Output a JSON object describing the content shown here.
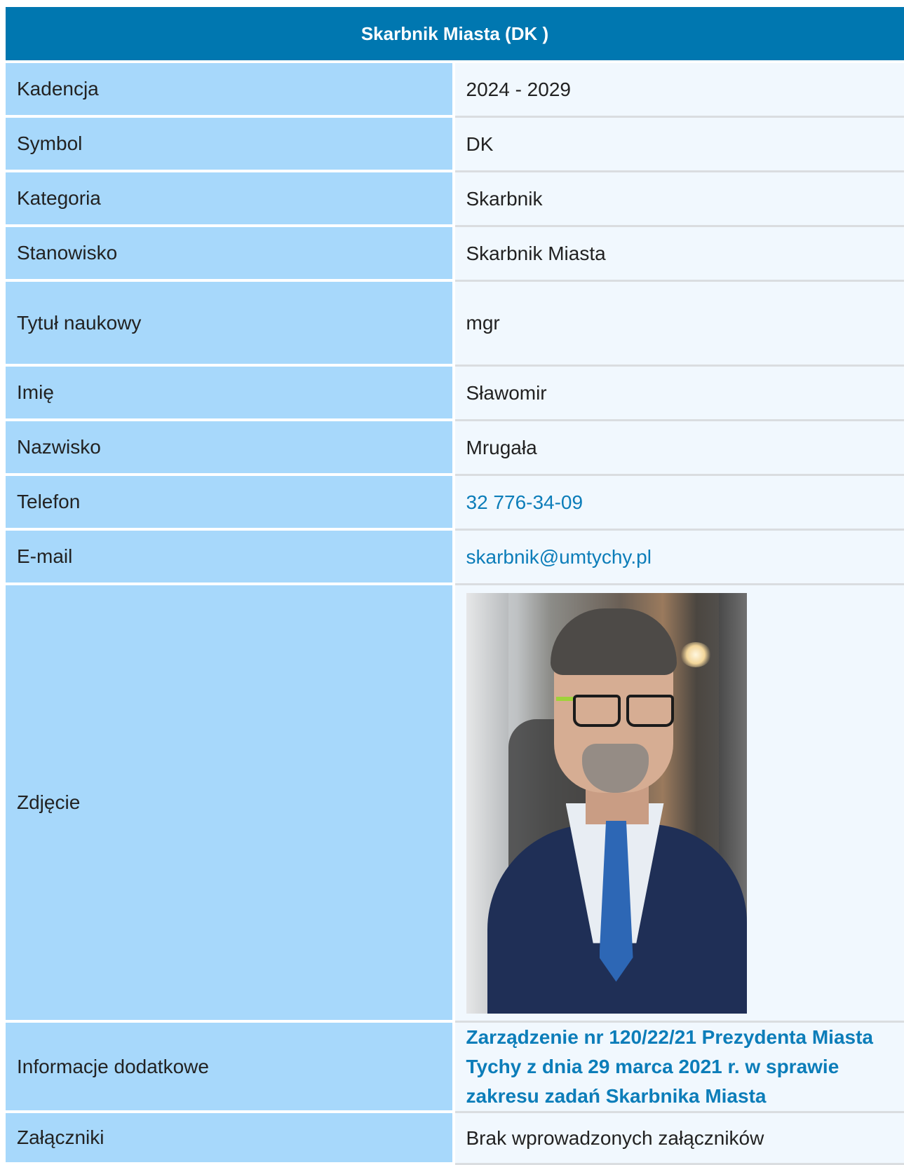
{
  "header": {
    "title": "Skarbnik Miasta (DK )"
  },
  "rows": {
    "kadencja": {
      "label": "Kadencja",
      "value": "2024 - 2029"
    },
    "symbol": {
      "label": "Symbol",
      "value": "DK"
    },
    "kategoria": {
      "label": "Kategoria",
      "value": "Skarbnik"
    },
    "stanowisko": {
      "label": "Stanowisko",
      "value": "Skarbnik Miasta"
    },
    "tytul": {
      "label": "Tytuł naukowy",
      "value": "mgr"
    },
    "imie": {
      "label": "Imię",
      "value": "Sławomir"
    },
    "nazwisko": {
      "label": "Nazwisko",
      "value": "Mrugała"
    },
    "telefon": {
      "label": "Telefon",
      "value": "32 776-34-09"
    },
    "email": {
      "label": "E-mail",
      "value": "skarbnik@umtychy.pl"
    },
    "zdjecie": {
      "label": "Zdjęcie"
    },
    "informacje": {
      "label": "Informacje dodatkowe",
      "value": "Zarządzenie nr 120/22/21 Prezydenta Miasta Tychy z dnia 29 marca 2021 r. w sprawie zakresu zadań Skarbnika Miasta"
    },
    "zalaczniki": {
      "label": "Załączniki",
      "value": "Brak wprowadzonych załączników"
    }
  },
  "colors": {
    "header_bg": "#0077b0",
    "label_bg": "#a7d8fb",
    "value_bg": "#f1f8fe",
    "link": "#0c7db9"
  }
}
